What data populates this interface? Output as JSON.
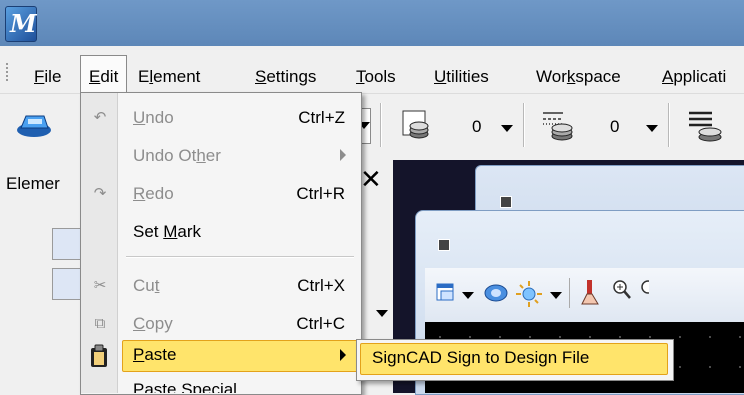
{
  "app": {
    "logo_letter": "M"
  },
  "menubar": {
    "items": [
      {
        "label": "File",
        "accel": "F",
        "rest": "ile"
      },
      {
        "label": "Edit",
        "accel": "E",
        "rest": "dit"
      },
      {
        "label": "Element",
        "pre": "E",
        "accel": "l",
        "rest": "ement"
      },
      {
        "label": "Settings",
        "accel": "S",
        "rest": "ettings"
      },
      {
        "label": "Tools",
        "accel": "T",
        "rest": "ools"
      },
      {
        "label": "Utilities",
        "accel": "U",
        "rest": "tilities"
      },
      {
        "label": "Workspace",
        "pre": "Wor",
        "accel": "k",
        "rest": "space"
      },
      {
        "label": "Applicati",
        "accel": "A",
        "rest": "pplicati"
      }
    ]
  },
  "toolbar": {
    "level_value_1": "0",
    "level_value_2": "0"
  },
  "panel": {
    "title": "Elemer",
    "close_glyph": "✕"
  },
  "edit_menu": {
    "undo": {
      "pre": "",
      "accel": "U",
      "rest": "ndo",
      "shortcut": "Ctrl+Z"
    },
    "undo_other": {
      "pre": "Undo Ot",
      "accel": "h",
      "rest": "er"
    },
    "redo": {
      "pre": "",
      "accel": "R",
      "rest": "edo",
      "shortcut": "Ctrl+R"
    },
    "set_mark": {
      "pre": "Set ",
      "accel": "M",
      "rest": "ark"
    },
    "cut": {
      "pre": "Cu",
      "accel": "t",
      "rest": "",
      "shortcut": "Ctrl+X"
    },
    "copy": {
      "pre": "",
      "accel": "C",
      "rest": "opy",
      "shortcut": "Ctrl+C"
    },
    "paste": {
      "pre": "",
      "accel": "P",
      "rest": "aste"
    },
    "paste_special": {
      "partial": "Paste Special"
    }
  },
  "paste_submenu": {
    "item": "SignCAD Sign to Design File"
  },
  "colors": {
    "titlebar": "#6390c2",
    "highlight": "#ffe46b",
    "highlight_border": "#e3a21a",
    "view_bg": "#000000"
  }
}
